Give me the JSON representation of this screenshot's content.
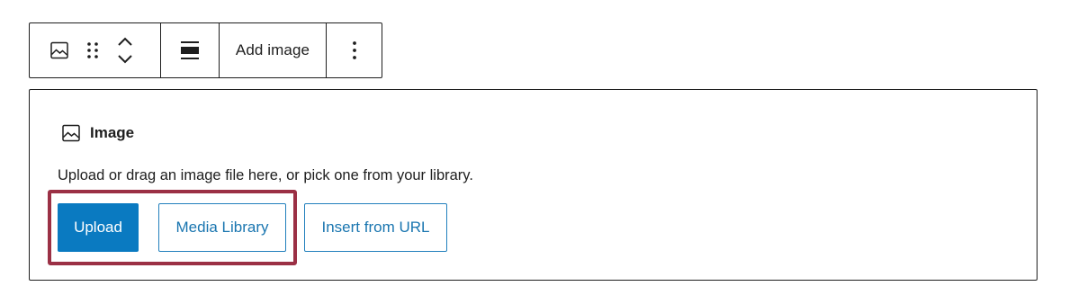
{
  "toolbar": {
    "block_icon": "image-icon",
    "drag_icon": "drag-handle-icon",
    "move_up_icon": "chevron-up-icon",
    "move_down_icon": "chevron-down-icon",
    "align_icon": "align-icon",
    "add_image_label": "Add image",
    "more_icon": "more-vertical-icon"
  },
  "placeholder": {
    "label_icon": "image-icon",
    "label": "Image",
    "instructions": "Upload or drag an image file here, or pick one from your library.",
    "buttons": {
      "upload": "Upload",
      "media_library": "Media Library",
      "insert_url": "Insert from URL"
    }
  },
  "colors": {
    "primary": "#0a7ac1",
    "secondary_text": "#1a76b0",
    "highlight": "#9b3045",
    "border": "#1e1e1e"
  }
}
